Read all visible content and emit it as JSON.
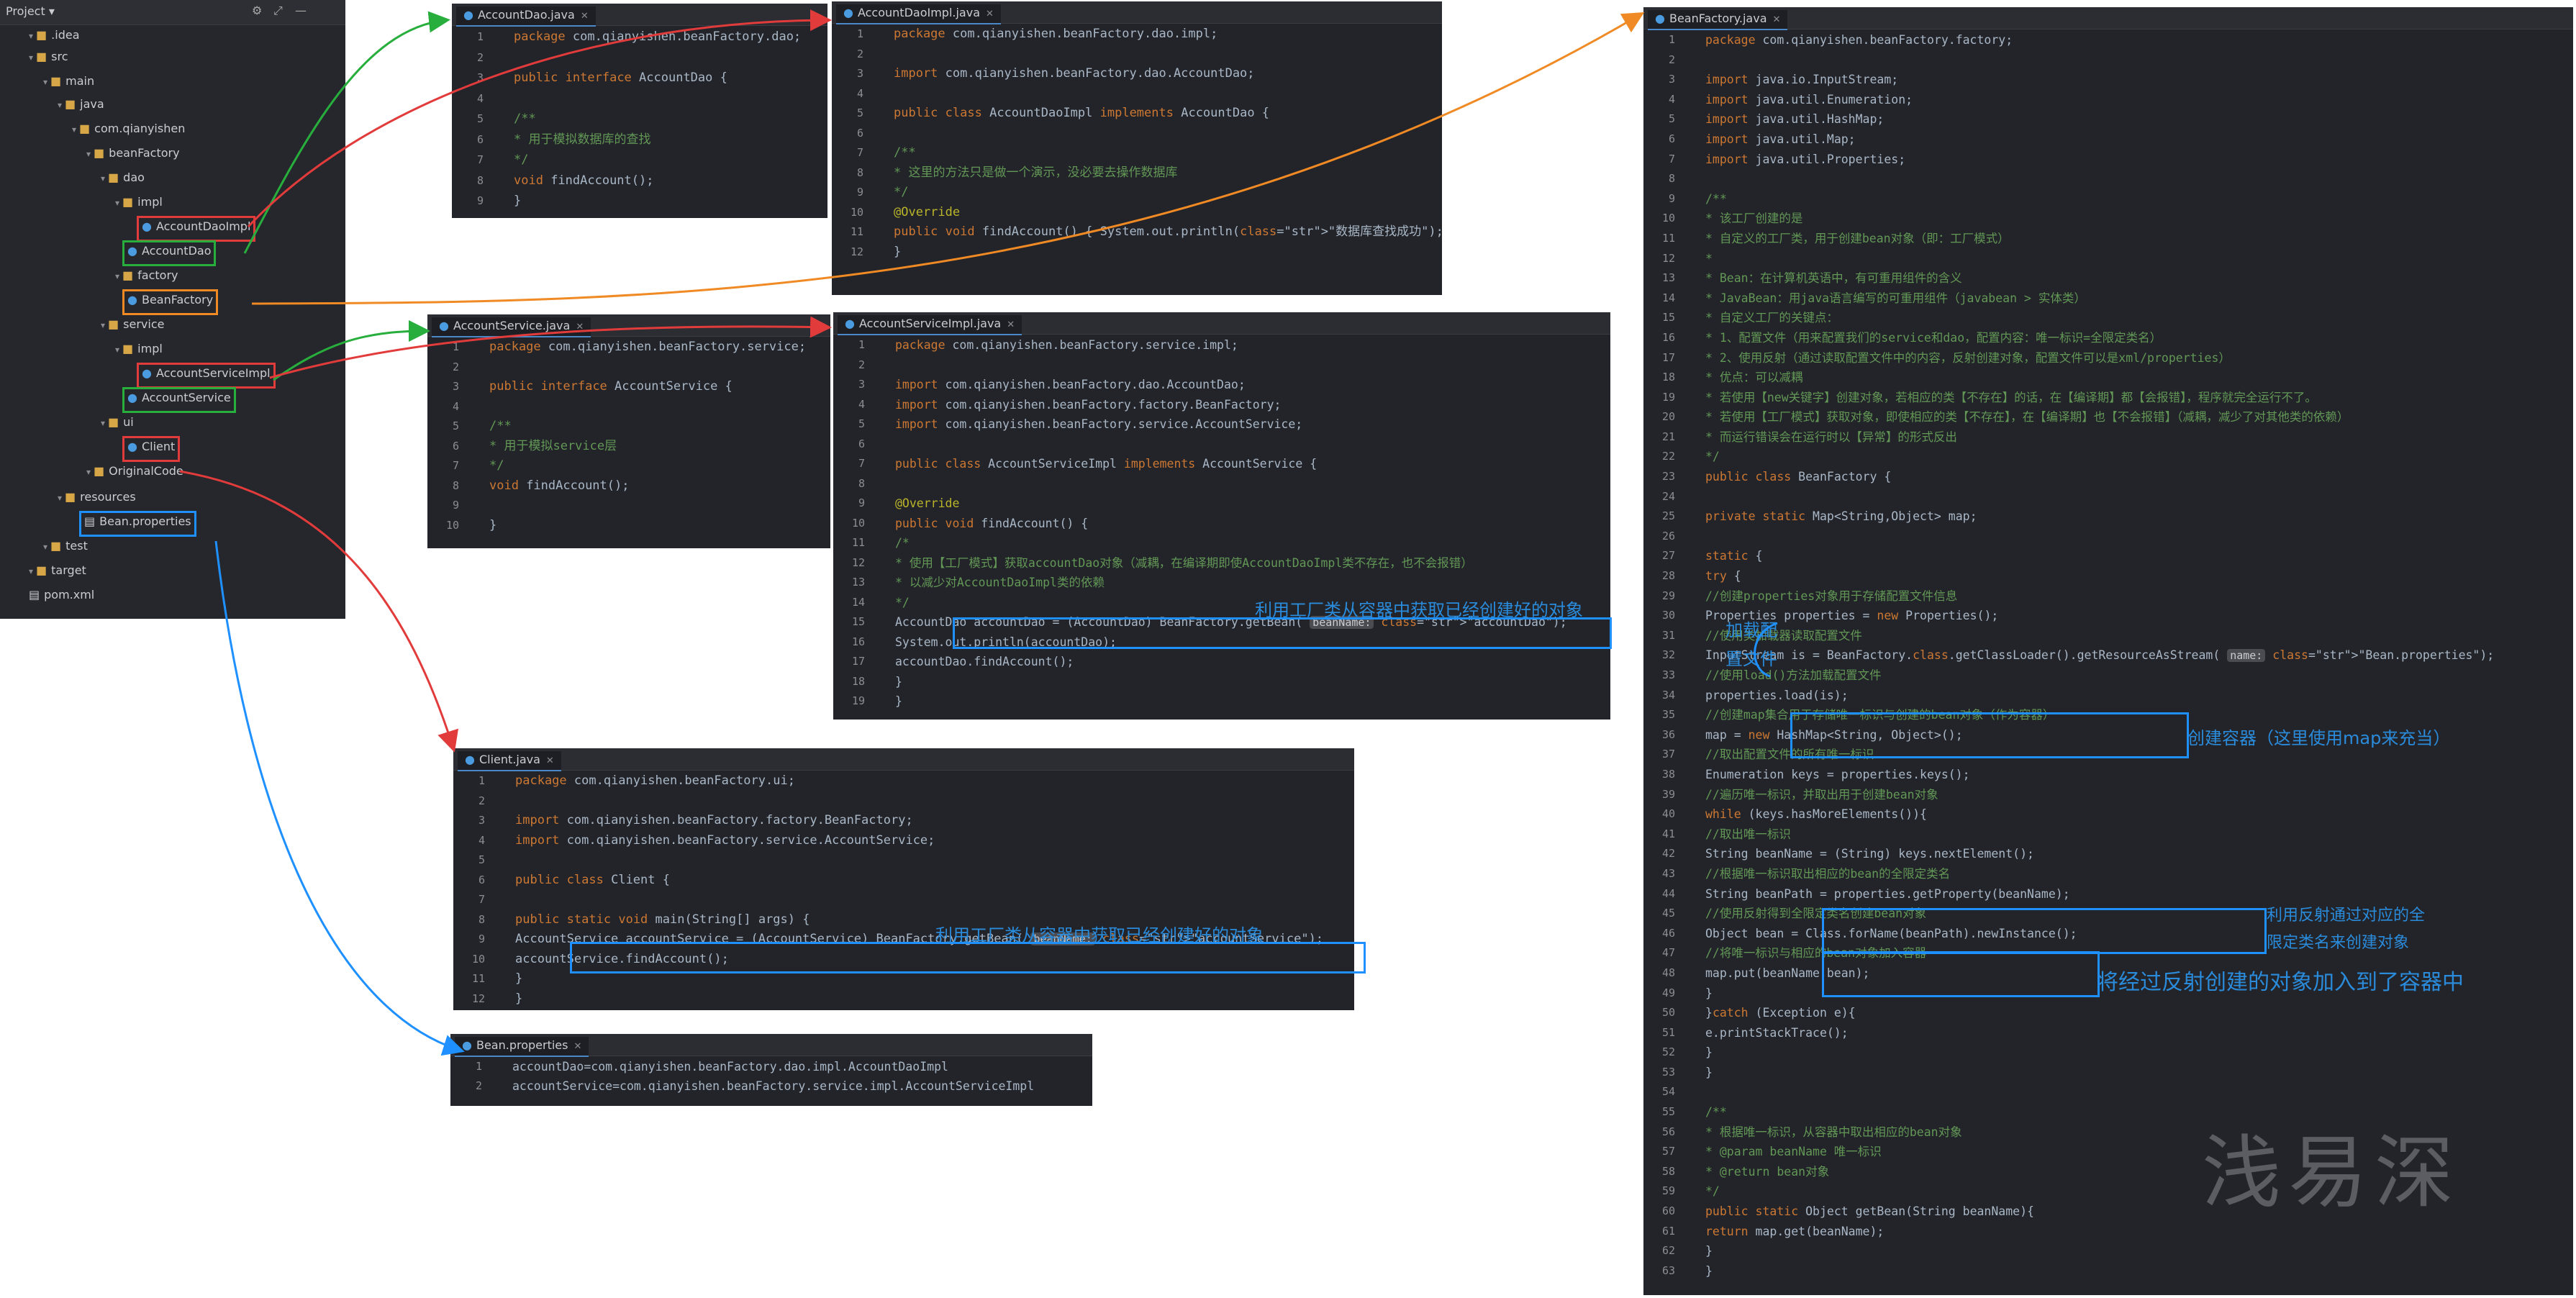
{
  "project_tree": {
    "header": "Project",
    "items": [
      {
        "label": ".idea",
        "kind": "folder"
      },
      {
        "label": "src",
        "kind": "folder"
      },
      {
        "label": "main",
        "kind": "folder"
      },
      {
        "label": "java",
        "kind": "folder"
      },
      {
        "label": "com.qianyishen",
        "kind": "folder"
      },
      {
        "label": "beanFactory",
        "kind": "folder"
      },
      {
        "label": "dao",
        "kind": "folder"
      },
      {
        "label": "impl",
        "kind": "folder"
      },
      {
        "label": "AccountDaoImpl",
        "kind": "class"
      },
      {
        "label": "AccountDao",
        "kind": "class"
      },
      {
        "label": "factory",
        "kind": "folder"
      },
      {
        "label": "BeanFactory",
        "kind": "class"
      },
      {
        "label": "service",
        "kind": "folder"
      },
      {
        "label": "impl",
        "kind": "folder"
      },
      {
        "label": "AccountServiceImpl",
        "kind": "class"
      },
      {
        "label": "AccountService",
        "kind": "class"
      },
      {
        "label": "ui",
        "kind": "folder"
      },
      {
        "label": "Client",
        "kind": "class"
      },
      {
        "label": "OriginalCode",
        "kind": "folder"
      },
      {
        "label": "resources",
        "kind": "folder"
      },
      {
        "label": "Bean.properties",
        "kind": "file"
      },
      {
        "label": "test",
        "kind": "folder"
      },
      {
        "label": "target",
        "kind": "folder"
      },
      {
        "label": "pom.xml",
        "kind": "file"
      }
    ]
  },
  "panels": {
    "dao": {
      "tab": "AccountDao.java",
      "lines": [
        "package com.qianyishen.beanFactory.dao;",
        "",
        "public interface AccountDao {",
        "",
        "    /**",
        "     * 用于模拟数据库的查找",
        "     */",
        "    void findAccount();",
        "}"
      ]
    },
    "daoimpl": {
      "tab": "AccountDaoImpl.java",
      "lines": [
        "package com.qianyishen.beanFactory.dao.impl;",
        "",
        "import com.qianyishen.beanFactory.dao.AccountDao;",
        "",
        "public class AccountDaoImpl implements AccountDao {",
        "",
        "    /**",
        "     * 这里的方法只是做一个演示，没必要去操作数据库",
        "     */",
        "    @Override",
        "    public void findAccount() { System.out.println(\"数据库查找成功\"); }",
        "}"
      ]
    },
    "service": {
      "tab": "AccountService.java",
      "lines": [
        "package com.qianyishen.beanFactory.service;",
        "",
        "public interface AccountService {",
        "",
        "    /**",
        "     * 用于模拟service层",
        "     */",
        "    void findAccount();",
        "",
        "}"
      ]
    },
    "serviceimpl": {
      "tab": "AccountServiceImpl.java",
      "lines": [
        "package com.qianyishen.beanFactory.service.impl;",
        "",
        "import com.qianyishen.beanFactory.dao.AccountDao;",
        "import com.qianyishen.beanFactory.factory.BeanFactory;",
        "import com.qianyishen.beanFactory.service.AccountService;",
        "",
        "public class AccountServiceImpl implements AccountService {",
        "",
        "    @Override",
        "    public void findAccount() {",
        "        /*",
        "         * 使用【工厂模式】获取accountDao对象（减耦，在编译期即使AccountDaoImpl类不存在，也不会报错）",
        "         * 以减少对AccountDaoImpl类的依赖",
        "         */",
        "        AccountDao accountDao = (AccountDao) BeanFactory.getBean( beanName: \"accountDao\");",
        "        System.out.println(accountDao);",
        "        accountDao.findAccount();",
        "    }",
        "}"
      ]
    },
    "client": {
      "tab": "Client.java",
      "lines": [
        "package com.qianyishen.beanFactory.ui;",
        "",
        "import com.qianyishen.beanFactory.factory.BeanFactory;",
        "import com.qianyishen.beanFactory.service.AccountService;",
        "",
        "public class Client {",
        "",
        "    public static void main(String[] args) {",
        "        AccountService accountService = (AccountService) BeanFactory.getBean( beanName: \"accountService\");",
        "        accountService.findAccount();",
        "    }",
        "}"
      ]
    },
    "props": {
      "tab": "Bean.properties",
      "lines": [
        "accountDao=com.qianyishen.beanFactory.dao.impl.AccountDaoImpl",
        "accountService=com.qianyishen.beanFactory.service.impl.AccountServiceImpl"
      ]
    },
    "factory": {
      "tab": "BeanFactory.java",
      "lines": [
        "package com.qianyishen.beanFactory.factory;",
        "",
        "import java.io.InputStream;",
        "import java.util.Enumeration;",
        "import java.util.HashMap;",
        "import java.util.Map;",
        "import java.util.Properties;",
        "",
        "/**",
        " * 该工厂创建的是",
        " * 自定义的工厂类，用于创建bean对象（即：工厂模式）",
        " *",
        " * Bean：在计算机英语中，有可重用组件的含义",
        " * JavaBean：用java语言编写的可重用组件（javabean > 实体类）",
        " *  自定义工厂的关键点：",
        " *      1、配置文件（用来配置我们的service和dao，配置内容：唯一标识=全限定类名）",
        " *      2、使用反射（通过读取配置文件中的内容，反射创建对象，配置文件可以是xml/properties）",
        " * 优点：可以减耦",
        " * 若使用【new关键字】创建对象，若相应的类【不存在】的话，在【编译期】都【会报错】，程序就完全运行不了。",
        " * 若使用【工厂模式】获取对象，即使相应的类【不存在】，在【编译期】也【不会报错】（减耦，减少了对其他类的依赖）",
        " *      而运行错误会在运行时以【异常】的形式反出",
        " */",
        "public class BeanFactory {",
        "",
        "    private static Map<String,Object> map;",
        "",
        "    static {",
        "        try {",
        "            //创建properties对象用于存储配置文件信息",
        "            Properties properties = new Properties();",
        "            //使用类加载器读取配置文件",
        "            InputStream is = BeanFactory.class.getClassLoader().getResourceAsStream( name: \"Bean.properties\");",
        "            //使用load()方法加载配置文件",
        "            properties.load(is);",
        "            //创建map集合用于存储唯一标识与创建的bean对象（作为容器）",
        "            map = new HashMap<String, Object>();",
        "            //取出配置文件的所有唯一标识",
        "            Enumeration keys = properties.keys();",
        "            //遍历唯一标识，并取出用于创建bean对象",
        "            while (keys.hasMoreElements()){",
        "                //取出唯一标识",
        "                String beanName = (String) keys.nextElement();",
        "                //根据唯一标识取出相应的bean的全限定类名",
        "                String beanPath = properties.getProperty(beanName);",
        "                //使用反射得到全限定类名创建bean对象",
        "                Object bean = Class.forName(beanPath).newInstance();",
        "                //将唯一标识与相应的bean对象加入容器",
        "                map.put(beanName,bean);",
        "            }",
        "        }catch (Exception e){",
        "            e.printStackTrace();",
        "        }",
        "    }",
        "",
        "    /**",
        "     * 根据唯一标识，从容器中取出相应的bean对象",
        "     * @param beanName 唯一标识",
        "     * @return bean对象",
        "     */",
        "    public static Object getBean(String beanName){",
        "        return map.get(beanName);",
        "    }",
        "}"
      ]
    }
  },
  "annotations": {
    "service_impl": "利用工厂类从容器中获取已经创建好的对象",
    "client": "利用工厂类从容器中获取已经创建好的对象",
    "load_line1": "加载配",
    "load_line2": "置文件",
    "create_container": "创建容器（这里使用map来充当）",
    "reflect_line1": "利用反射通过对应的全",
    "reflect_line2": "限定类名来创建对象",
    "put_container": "将经过反射创建的对象加入到了容器中"
  },
  "watermark": "浅易深"
}
